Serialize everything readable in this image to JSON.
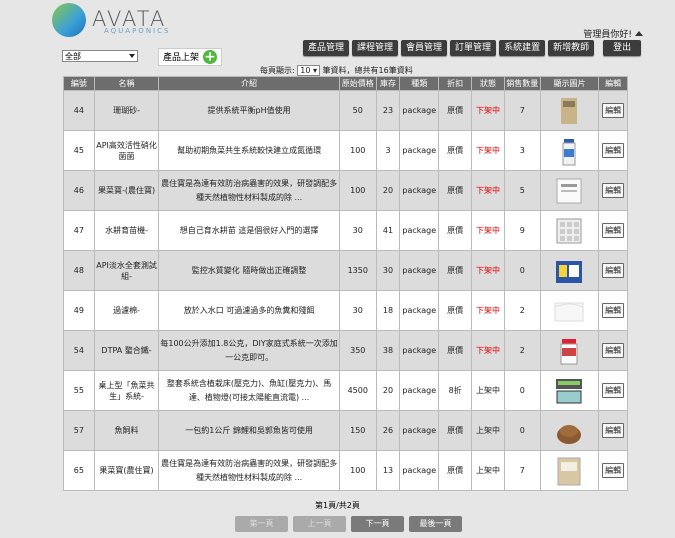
{
  "header": {
    "logo_text": "AVATA",
    "logo_sub": "AQUAPONICS",
    "user_menu": "管理員你好!"
  },
  "nav": [
    "產品管理",
    "課程管理",
    "會員管理",
    "訂單管理",
    "系統建置",
    "新增教師"
  ],
  "logout_label": "登出",
  "filter": {
    "selected": "全部"
  },
  "add_button": {
    "label": "產品上架"
  },
  "per_page": {
    "prefix": "每頁顯示:",
    "value": "10",
    "suffix": "筆資料，總共有16筆資料"
  },
  "columns": [
    "編號",
    "名稱",
    "介紹",
    "原始價格",
    "庫存",
    "種類",
    "折扣",
    "狀態",
    "銷售數量",
    "顯示圖片",
    "編輯"
  ],
  "edit_label": "編輯",
  "rows": [
    {
      "id": "44",
      "name": "珊瑚砂-",
      "intro": "提供系統平衡pH值使用",
      "price": "50",
      "stock": "23",
      "type": "package",
      "discount": "原價",
      "status": "下架中",
      "sold": "7",
      "img": "sand-bag"
    },
    {
      "id": "45",
      "name": "API高效活性硝化菌菌",
      "intro": "幫助初期魚菜共生系統較快建立成氮循環",
      "price": "100",
      "stock": "3",
      "type": "package",
      "discount": "原價",
      "status": "下架中",
      "sold": "3",
      "img": "bottle"
    },
    {
      "id": "46",
      "name": "果菜寶-(農住寶)",
      "intro": "農住寶是為達有效防治病蟲害的效果，研發調配多種天然植物性材料製成的除 ...",
      "price": "100",
      "stock": "20",
      "type": "package",
      "discount": "原價",
      "status": "下架中",
      "sold": "5",
      "img": "packet"
    },
    {
      "id": "47",
      "name": "水耕育苗機-",
      "intro": "想自己育水耕苗 這是個很好入門的選擇",
      "price": "30",
      "stock": "41",
      "type": "package",
      "discount": "原價",
      "status": "下架中",
      "sold": "9",
      "img": "tray"
    },
    {
      "id": "48",
      "name": "API淡水全套測試組-",
      "intro": "監控水質變化 隨時做出正確調整",
      "price": "1350",
      "stock": "30",
      "type": "package",
      "discount": "原價",
      "status": "下架中",
      "sold": "0",
      "img": "test-kit"
    },
    {
      "id": "49",
      "name": "過濾棉-",
      "intro": "放於入水口 可過濾過多的魚糞和殘餌",
      "price": "30",
      "stock": "18",
      "type": "package",
      "discount": "原價",
      "status": "下架中",
      "sold": "2",
      "img": "cotton"
    },
    {
      "id": "54",
      "name": "DTPA 螯合鐵-",
      "intro": "每100公升添加1.8公克，DIY家庭式系統一次添加一公克即可。",
      "price": "350",
      "stock": "38",
      "type": "package",
      "discount": "原價",
      "status": "下架中",
      "sold": "2",
      "img": "jar"
    },
    {
      "id": "55",
      "name": "桌上型「魚菜共生」系統-",
      "intro": "整套系統含植栽床(壓克力)、魚缸(壓克力)、馬達、植物燈(可接太陽能直流電) ...",
      "price": "4500",
      "stock": "20",
      "type": "package",
      "discount": "8折",
      "status": "上架中",
      "sold": "0",
      "img": "system"
    },
    {
      "id": "57",
      "name": "魚飼料",
      "intro": "一包約1公斤 錦鯉和吳郭魚皆可使用",
      "price": "150",
      "stock": "26",
      "type": "package",
      "discount": "原價",
      "status": "上架中",
      "sold": "0",
      "img": "feed"
    },
    {
      "id": "65",
      "name": "果菜寶(農住寶)",
      "intro": "農住寶是為達有效防治病蟲害的效果，研發調配多種天然植物性材料製成的除 ...",
      "price": "100",
      "stock": "13",
      "type": "package",
      "discount": "原價",
      "status": "上架中",
      "sold": "7",
      "img": "packet-2"
    }
  ],
  "pagination": {
    "info": "第1頁/共2頁",
    "first": "第一頁",
    "prev": "上一頁",
    "next": "下一頁",
    "last": "最後一頁"
  },
  "colors": {
    "off": "#dd0000",
    "header_bg": "#6d6d6d",
    "nav_bg": "#3c3c3c",
    "add_green": "#4fb83a"
  }
}
